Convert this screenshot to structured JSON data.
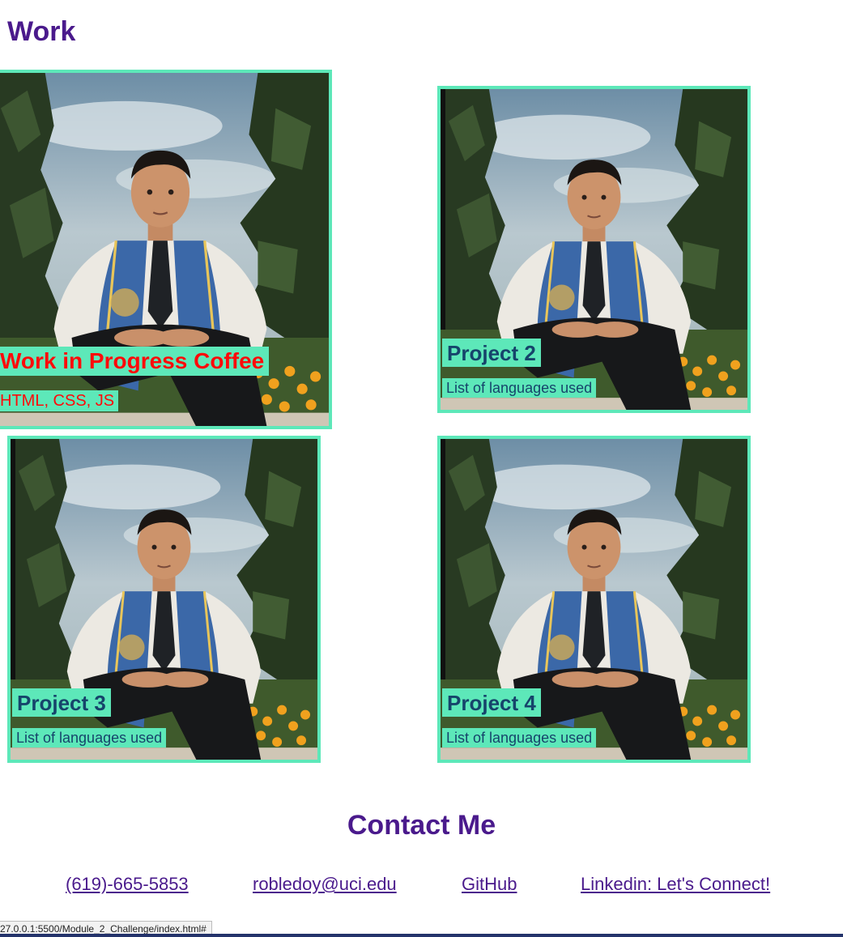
{
  "work": {
    "title": "Work",
    "projects": [
      {
        "title": "Work in Progress Coffee",
        "subtitle": "HTML, CSS, JS"
      },
      {
        "title": "Project 2",
        "subtitle": "List of languages used"
      },
      {
        "title": "Project 3",
        "subtitle": "List of languages used"
      },
      {
        "title": "Project 4",
        "subtitle": "List of languages used"
      }
    ]
  },
  "contact": {
    "title": "Contact Me",
    "links": [
      "(619)-665-5853",
      "robledoy@uci.edu",
      "GitHub",
      "Linkedin: Let's Connect!"
    ]
  },
  "status_bar": {
    "url": "27.0.0.1:5500/Module_2_Challenge/index.html#"
  },
  "colors": {
    "accent": "#5de8b9",
    "heading": "#4a1a8c",
    "label_text": "#16446b",
    "featured_text": "#ff0a0a"
  }
}
